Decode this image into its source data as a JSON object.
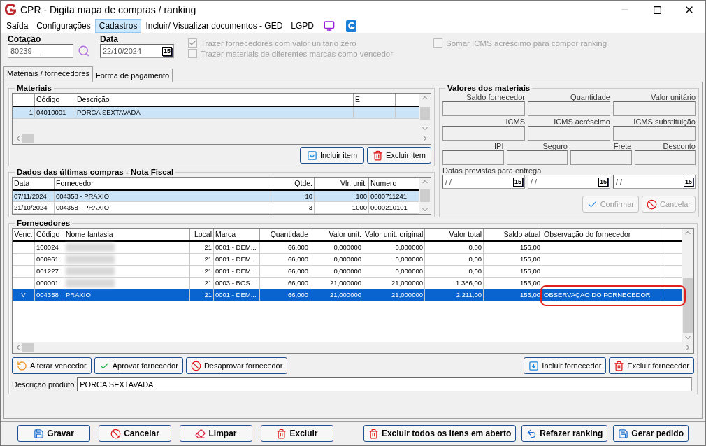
{
  "window": {
    "title": "CPR - Digita mapa de compras / ranking"
  },
  "menu": [
    {
      "label": "Saída",
      "selected": false
    },
    {
      "label": "Configurações",
      "selected": false
    },
    {
      "label": "Cadastros",
      "selected": true
    },
    {
      "label": "Incluir/ Visualizar documentos - GED",
      "selected": false
    },
    {
      "label": "LGPD",
      "selected": false
    }
  ],
  "header": {
    "cotacao": {
      "label": "Cotação",
      "value": "80239__"
    },
    "data": {
      "label": "Data",
      "value": "22/10/2024",
      "calendar": "15"
    },
    "options": [
      {
        "label": "Trazer fornecedores com valor unitário zero",
        "checked": true,
        "disabled": true
      },
      {
        "label": "Trazer materiais de diferentes marcas como vencedor",
        "checked": false,
        "disabled": true
      }
    ],
    "extra_option": {
      "label": "Somar ICMS acréscimo para compor ranking",
      "checked": false,
      "disabled": true
    }
  },
  "tabs": [
    {
      "label": "Materiais / fornecedores",
      "selected": true
    },
    {
      "label": "Forma de pagamento",
      "selected": false
    }
  ],
  "materiais": {
    "title": "Materiais",
    "columns": [
      {},
      {
        "label": "Código"
      },
      {
        "label": "Descrição"
      },
      {
        "label": "E"
      }
    ],
    "rows": [
      {
        "cells": [
          "1",
          "04010001",
          "PORCA SEXTAVADA"
        ],
        "selected": true
      }
    ],
    "buttons": [
      {
        "label": "Incluir item"
      },
      {
        "label": "Excluir item"
      }
    ]
  },
  "ultimas_compras": {
    "title": "Dados das últimas compras - Nota Fiscal",
    "columns": [
      {
        "label": "Data"
      },
      {
        "label": "Fornecedor"
      },
      {
        "label": "Qtde."
      },
      {
        "label": "Vlr. unit."
      },
      {
        "label": "Numero"
      }
    ],
    "rows": [
      {
        "cells": [
          "07/11/2024",
          "004358 - PRAXIO",
          "10",
          "100",
          "0000711241"
        ],
        "selected": true
      },
      {
        "cells": [
          "21/10/2024",
          "004358 - PRAXIO",
          "3",
          "1000",
          "0000210101"
        ],
        "selected": false
      }
    ]
  },
  "valores": {
    "title": "Valores dos materiais",
    "rows": [
      [
        "Saldo fornecedor",
        "Quantidade",
        "Valor unitário"
      ],
      [
        "ICMS",
        "ICMS acréscimo",
        "ICMS substituição"
      ],
      [
        "IPI",
        "Seguro",
        "Frete",
        "Desconto"
      ]
    ],
    "dates_label": "Datas previstas para entrega",
    "dates": [
      {
        "value": "/ /",
        "calendar": "15"
      },
      {
        "value": "/ /",
        "calendar": "15"
      },
      {
        "value": "/ /",
        "calendar": "15"
      }
    ],
    "buttons": [
      {
        "label": "Confirmar",
        "disabled": true
      },
      {
        "label": "Cancelar",
        "disabled": true
      }
    ]
  },
  "fornecedores": {
    "title": "Fornecedores",
    "columns": [
      {
        "label": "Venc."
      },
      {
        "label": "Código"
      },
      {
        "label": "Nome fantasia"
      },
      {
        "label": "Local"
      },
      {
        "label": "Marca"
      },
      {
        "label": "Quantidade"
      },
      {
        "label": "Valor unit."
      },
      {
        "label": "Valor unit. original"
      },
      {
        "label": "Valor total"
      },
      {
        "label": "Saldo atual"
      },
      {
        "label": "Observação do fornecedor"
      }
    ],
    "rows": [
      {
        "codigo": "100024",
        "name_hidden": true,
        "local": "21",
        "marca": "0001 - DEM...",
        "quantidade": "66,000",
        "valor_unit": "0,000000",
        "valor_unit_original": "0,000000",
        "valor_total": "0,00",
        "saldo_atual": "156,00",
        "selected": false
      },
      {
        "codigo": "000961",
        "name_hidden": true,
        "local": "21",
        "marca": "0001 - DEM...",
        "quantidade": "66,000",
        "valor_unit": "0,000000",
        "valor_unit_original": "0,000000",
        "valor_total": "0,00",
        "saldo_atual": "156,00",
        "selected": false
      },
      {
        "codigo": "001227",
        "name_hidden": true,
        "local": "21",
        "marca": "0001 - DEM...",
        "quantidade": "66,000",
        "valor_unit": "0,000000",
        "valor_unit_original": "0,000000",
        "valor_total": "0,00",
        "saldo_atual": "156,00",
        "selected": false
      },
      {
        "codigo": "000001",
        "name_hidden": true,
        "local": "21",
        "marca": "0003 - BOS...",
        "quantidade": "66,000",
        "valor_unit": "21,000000",
        "valor_unit_original": "21,000000",
        "valor_total": "1.386,00",
        "saldo_atual": "156,00",
        "selected": false
      },
      {
        "venc": "V",
        "codigo": "004358",
        "name": "PRAXIO",
        "name_hidden": false,
        "local": "21",
        "marca": "0001 - DEM...",
        "quantidade": "66,000",
        "valor_unit": "21,000000",
        "valor_unit_original": "21,000000",
        "valor_total": "2.211,00",
        "saldo_atual": "156,00",
        "observacao": "OBSERVAÇÃO DO FORNECEDOR",
        "observacao_circled": true,
        "selected": true
      }
    ],
    "buttons_left": [
      {
        "label": "Alterar vencedor"
      },
      {
        "label": "Aprovar fornecedor"
      },
      {
        "label": "Desaprovar fornecedor"
      }
    ],
    "buttons_right": [
      {
        "label": "Incluir fornecedor"
      },
      {
        "label": "Excluir fornecedor"
      }
    ],
    "descricao": {
      "label": "Descrição produto",
      "value": "PORCA SEXTAVADA"
    }
  },
  "footer_left": [
    {
      "label": "Gravar"
    },
    {
      "label": "Cancelar"
    },
    {
      "label": "Limpar"
    },
    {
      "label": "Excluir"
    }
  ],
  "footer_right": [
    {
      "label": "Excluir todos os itens em aberto"
    },
    {
      "label": "Refazer ranking"
    },
    {
      "label": "Gerar pedido"
    }
  ]
}
